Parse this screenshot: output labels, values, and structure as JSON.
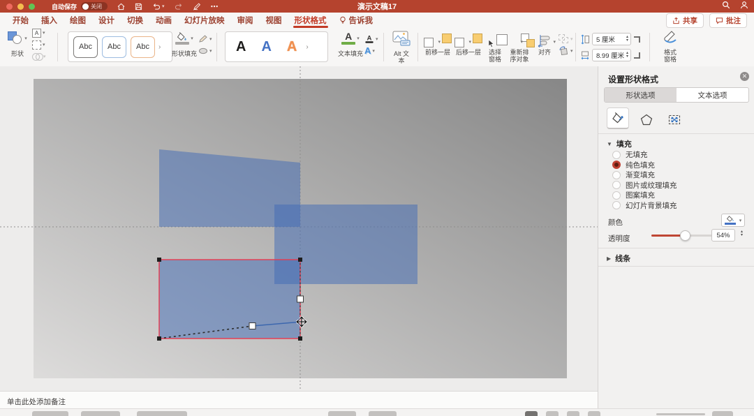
{
  "titlebar": {
    "autosave_label": "自动保存",
    "autosave_state": "关闭",
    "title": "演示文稿17"
  },
  "menubar": {
    "tabs": [
      "开始",
      "插入",
      "绘图",
      "设计",
      "切换",
      "动画",
      "幻灯片放映",
      "审阅",
      "视图",
      "形状格式",
      "告诉我"
    ],
    "active_tab": "形状格式",
    "share_label": "共享",
    "comments_label": "批注"
  },
  "ribbon": {
    "shapes_label": "形状",
    "style_chip": "Abc",
    "shape_fill_label": "形状填充",
    "wordart_letter": "A",
    "text_fill_label": "文本填充",
    "alt_text_label": "Alt 文本",
    "arrange": [
      "前移一层",
      "后移一层",
      "选择窗格",
      "重新排序对象",
      "对齐"
    ],
    "height_value": "5 厘米",
    "width_value": "8.99 厘米",
    "format_pane_label": "格式窗格"
  },
  "panel": {
    "title": "设置形状格式",
    "tab_shape": "形状选项",
    "tab_text": "文本选项",
    "fill_header": "填充",
    "fill_options": [
      "无填充",
      "纯色填充",
      "渐变填充",
      "图片或纹理填充",
      "图案填充",
      "幻灯片背景填充"
    ],
    "selected_fill_option": "纯色填充",
    "color_label": "颜色",
    "transparency_label": "透明度",
    "transparency_value": "54%",
    "transparency_percent": 54,
    "line_header": "线条"
  },
  "notes": {
    "placeholder": "单击此处添加备注"
  },
  "colors": {
    "titlebar_red": "#b5432e",
    "accent_red": "#c23b27",
    "selection_red": "#e8394e",
    "shape_blue": "#3f6ab5",
    "fill_green": "#70ad47",
    "wordart_blue": "#4472c4",
    "wordart_orange": "#ed8c4e",
    "slider_fill": "#bf4634"
  }
}
